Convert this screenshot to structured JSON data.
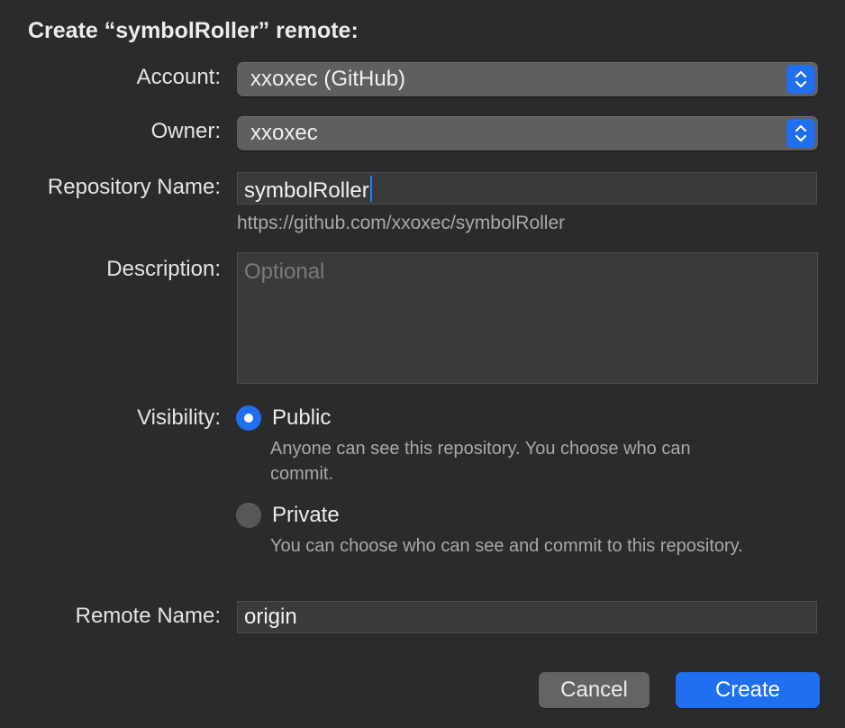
{
  "dialog": {
    "title": "Create “symbolRoller” remote:"
  },
  "account": {
    "label": "Account:",
    "value": "xxoxec (GitHub)"
  },
  "owner": {
    "label": "Owner:",
    "value": "xxoxec"
  },
  "repository": {
    "label": "Repository Name:",
    "value": "symbolRoller",
    "url": "https://github.com/xxoxec/symbolRoller"
  },
  "description": {
    "label": "Description:",
    "placeholder": "Optional",
    "value": ""
  },
  "visibility": {
    "label": "Visibility:",
    "selected": "Public",
    "options": [
      {
        "label": "Public",
        "description": "Anyone can see this repository. You choose who can commit."
      },
      {
        "label": "Private",
        "description": "You can choose who can see and commit to this repository."
      }
    ]
  },
  "remote": {
    "label": "Remote Name:",
    "value": "origin"
  },
  "buttons": {
    "cancel": "Cancel",
    "create": "Create"
  },
  "icons": {
    "popup_stepper": "chevron-up-down-icon"
  },
  "colors": {
    "accent": "#1f6ff0",
    "background": "#2b2b2d"
  }
}
